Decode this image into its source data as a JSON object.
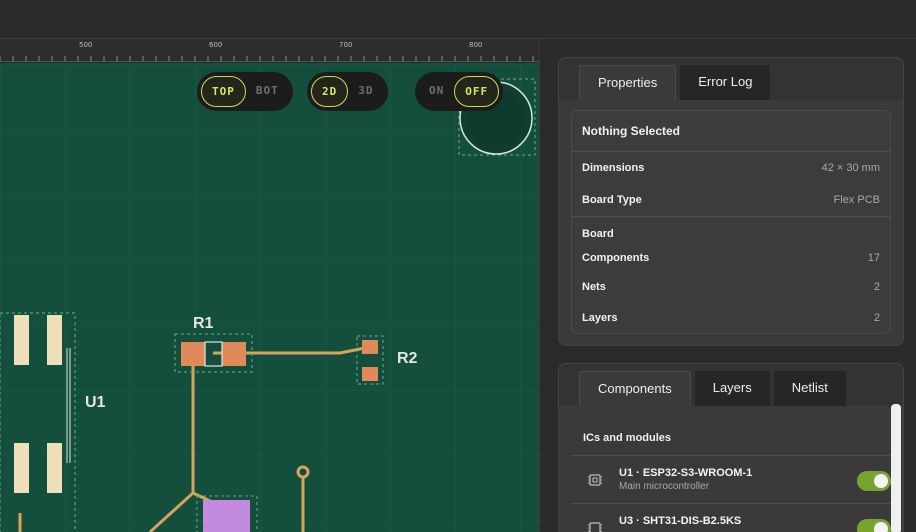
{
  "ruler": {
    "ticks": [
      "500",
      "600",
      "700",
      "800"
    ]
  },
  "view_toggles": [
    {
      "name": "side",
      "options": [
        "TOP",
        "BOT"
      ],
      "selected": "TOP"
    },
    {
      "name": "dimension",
      "options": [
        "2D",
        "3D"
      ],
      "selected": "2D"
    },
    {
      "name": "overlay",
      "options": [
        "ON",
        "OFF"
      ],
      "selected": "OFF"
    }
  ],
  "canvas": {
    "labels": {
      "r1": "R1",
      "r2": "R2",
      "u1": "U1"
    },
    "colors": {
      "board": "#144e3c",
      "pad": "#e08a5a",
      "trace": "#d6a45a",
      "ic_pad": "#eedfb8",
      "selected_part": "#c38ae0"
    }
  },
  "properties_panel": {
    "tabs": [
      "Properties",
      "Error Log"
    ],
    "active_tab": "Properties",
    "title": "Nothing Selected",
    "rows": [
      {
        "key": "Dimensions",
        "value": "42 × 30 mm"
      },
      {
        "key": "Board Type",
        "value": "Flex PCB"
      }
    ],
    "section": "Board",
    "section_rows": [
      {
        "key": "Components",
        "value": "17"
      },
      {
        "key": "Nets",
        "value": "2"
      },
      {
        "key": "Layers",
        "value": "2"
      }
    ]
  },
  "components_panel": {
    "tabs": [
      "Components",
      "Layers",
      "Netlist"
    ],
    "active_tab": "Components",
    "group": "ICs and modules",
    "items": [
      {
        "name": "U1 · ESP32-S3-WROOM-1",
        "desc": "Main microcontroller",
        "icon": "chip-icon",
        "enabled": true
      },
      {
        "name": "U3 · SHT31-DIS-B2.5KS",
        "desc": "",
        "icon": "chip-icon",
        "enabled": true
      }
    ],
    "toggle_color": "#7aa32d"
  }
}
